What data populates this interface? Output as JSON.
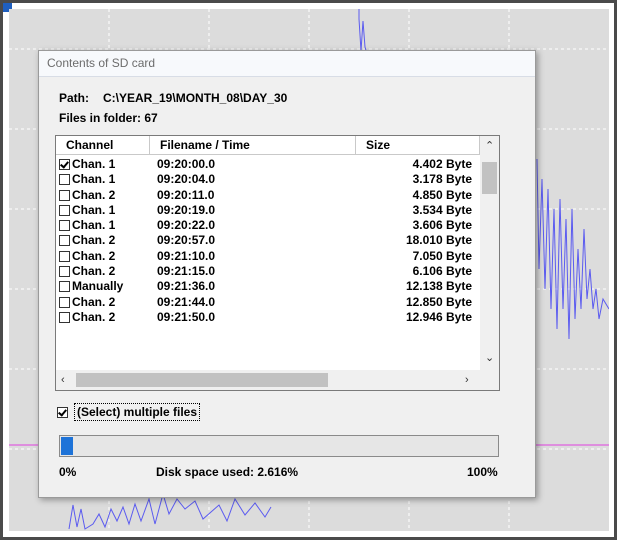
{
  "dialog": {
    "title": "Contents of SD card",
    "path_label": "Path:",
    "path_value": "C:\\YEAR_19\\MONTH_08\\DAY_30",
    "files_label": "Files in folder: 67"
  },
  "table": {
    "columns": [
      "Channel",
      "Filename / Time",
      "Size"
    ],
    "rows": [
      {
        "checked": true,
        "channel": "Chan. 1",
        "time": "09:20:00.0",
        "size": "4.402 Byte"
      },
      {
        "checked": false,
        "channel": "Chan. 1",
        "time": "09:20:04.0",
        "size": "3.178 Byte"
      },
      {
        "checked": false,
        "channel": "Chan. 2",
        "time": "09:20:11.0",
        "size": "4.850 Byte"
      },
      {
        "checked": false,
        "channel": "Chan. 1",
        "time": "09:20:19.0",
        "size": "3.534 Byte"
      },
      {
        "checked": false,
        "channel": "Chan. 1",
        "time": "09:20:22.0",
        "size": "3.606 Byte"
      },
      {
        "checked": false,
        "channel": "Chan. 2",
        "time": "09:20:57.0",
        "size": "18.010 Byte"
      },
      {
        "checked": false,
        "channel": "Chan. 2",
        "time": "09:21:10.0",
        "size": "7.050 Byte"
      },
      {
        "checked": false,
        "channel": "Chan. 2",
        "time": "09:21:15.0",
        "size": "6.106 Byte"
      },
      {
        "checked": false,
        "channel": "Manually",
        "time": "09:21:36.0",
        "size": "12.138 Byte"
      },
      {
        "checked": false,
        "channel": "Chan. 2",
        "time": "09:21:44.0",
        "size": "12.850 Byte"
      },
      {
        "checked": false,
        "channel": "Chan. 2",
        "time": "09:21:50.0",
        "size": "12.946 Byte"
      }
    ]
  },
  "multi_select": {
    "checked": true,
    "label": "(Select) multiple files"
  },
  "disk": {
    "min_label": "0%",
    "max_label": "100%",
    "used_text": "Disk space used: 2.616%",
    "used_fraction": 0.02616
  },
  "icons": {
    "scroll_up": "chevron-up-icon",
    "scroll_down": "chevron-down-icon",
    "scroll_left": "chevron-left-icon",
    "scroll_right": "chevron-right-icon"
  },
  "colors": {
    "progress_fill": "#1e73d8",
    "signal_trace": "#5b5bf0",
    "marker_line": "#e040e0",
    "plot_background": "#dcdcdc"
  }
}
